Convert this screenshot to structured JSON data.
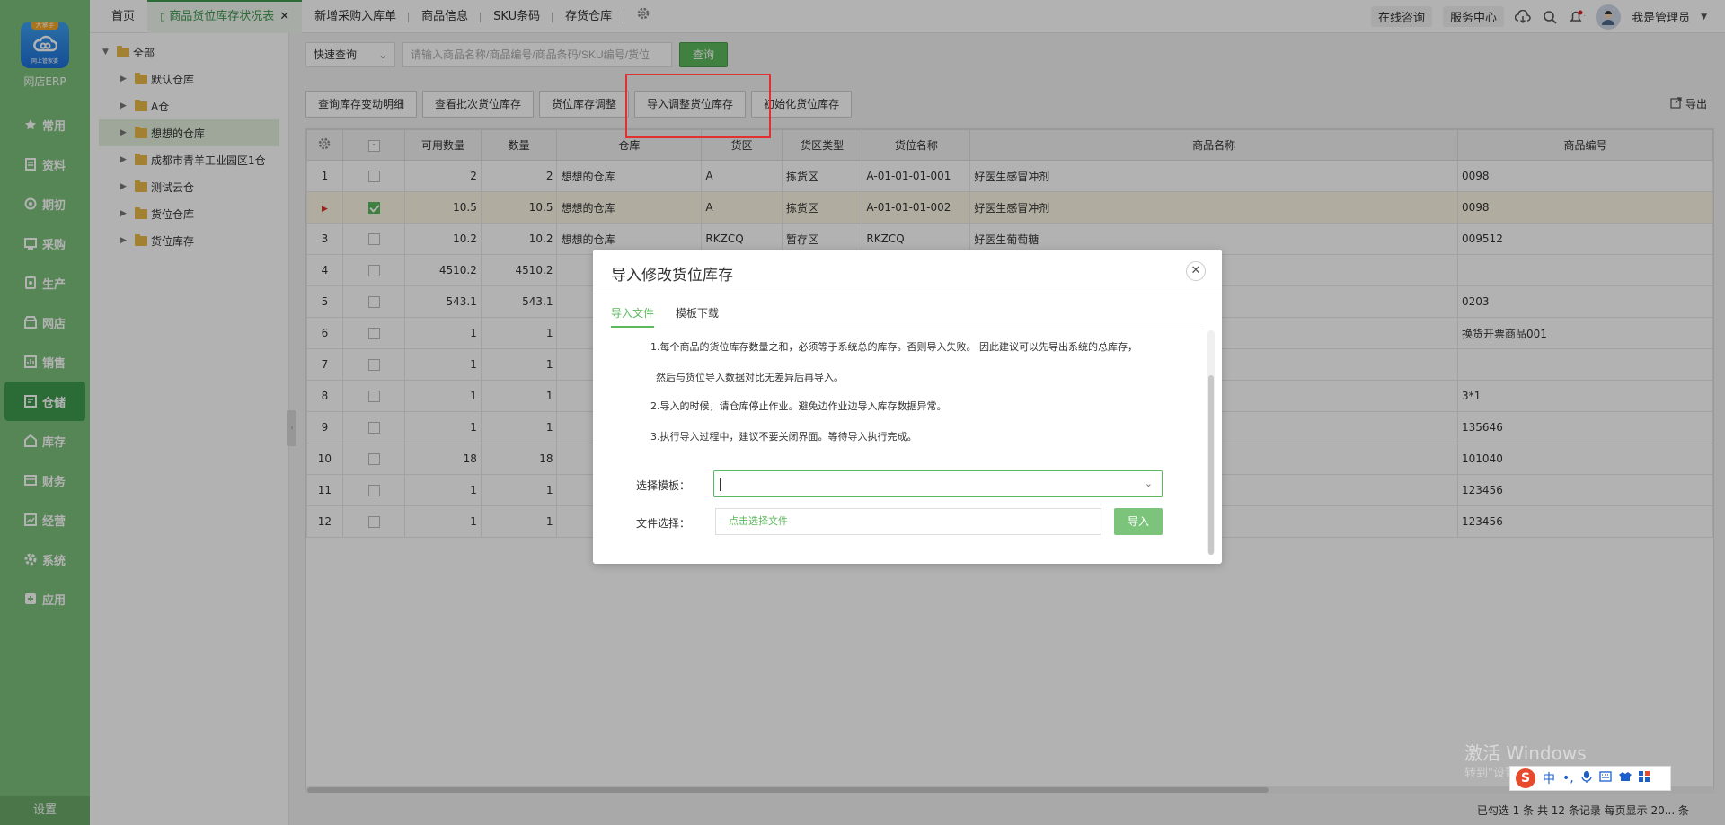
{
  "app": {
    "brand": "网店ERP",
    "logo_badge": "大掌手",
    "logo_sub": "网上管家婆",
    "settings_label": "设置"
  },
  "nav": [
    {
      "label": "常用",
      "icon": "star-icon"
    },
    {
      "label": "资料",
      "icon": "document-icon"
    },
    {
      "label": "期初",
      "icon": "target-icon"
    },
    {
      "label": "采购",
      "icon": "purchase-icon"
    },
    {
      "label": "生产",
      "icon": "production-icon"
    },
    {
      "label": "网店",
      "icon": "store-icon"
    },
    {
      "label": "销售",
      "icon": "chart-icon"
    },
    {
      "label": "仓储",
      "icon": "warehouse-icon"
    },
    {
      "label": "库存",
      "icon": "inventory-icon"
    },
    {
      "label": "财务",
      "icon": "finance-icon"
    },
    {
      "label": "经营",
      "icon": "business-icon"
    },
    {
      "label": "系统",
      "icon": "system-icon"
    },
    {
      "label": "应用",
      "icon": "apps-icon"
    }
  ],
  "tabs": [
    "首页",
    "商品货位库存状况表",
    "新增采购入库单",
    "商品信息",
    "SKU条码",
    "存货仓库"
  ],
  "topright": {
    "consult": "在线咨询",
    "service": "服务中心",
    "user": "我是管理员"
  },
  "tree": {
    "root": "全部",
    "items": [
      "默认仓库",
      "A仓",
      "想想的仓库",
      "成都市青羊工业园区1仓",
      "测试云仓",
      "货位仓库",
      "货位库存"
    ]
  },
  "search": {
    "mode": "快速查询",
    "placeholder": "请输入商品名称/商品编号/商品条码/SKU编号/货位",
    "button": "查询"
  },
  "actions": [
    "查询库存变动明细",
    "查看批次货位库存",
    "货位库存调整",
    "导入调整货位库存",
    "初始化货位库存"
  ],
  "export_label": "导出",
  "table": {
    "headers": [
      "可用数量",
      "数量",
      "仓库",
      "货区",
      "货区类型",
      "货位名称",
      "商品名称",
      "商品编号"
    ],
    "rows": [
      {
        "no": "1",
        "avail": "2",
        "qty": "2",
        "wh": "想想的仓库",
        "zone": "A",
        "ztype": "拣货区",
        "loc": "A-01-01-01-001",
        "name": "好医生感冒冲剂",
        "code": "0098"
      },
      {
        "no": "",
        "avail": "10.5",
        "qty": "10.5",
        "wh": "想想的仓库",
        "zone": "A",
        "ztype": "拣货区",
        "loc": "A-01-01-01-002",
        "name": "好医生感冒冲剂",
        "code": "0098"
      },
      {
        "no": "3",
        "avail": "10.2",
        "qty": "10.2",
        "wh": "想想的仓库",
        "zone": "RKZCQ",
        "ztype": "暂存区",
        "loc": "RKZCQ",
        "name": "好医生葡萄糖",
        "code": "009512"
      },
      {
        "no": "4",
        "avail": "4510.2",
        "qty": "4510.2",
        "wh": "",
        "zone": "",
        "ztype": "",
        "loc": "",
        "name": "",
        "code": ""
      },
      {
        "no": "5",
        "avail": "543.1",
        "qty": "543.1",
        "wh": "",
        "zone": "",
        "ztype": "",
        "loc": "",
        "name": "",
        "code": "0203"
      },
      {
        "no": "6",
        "avail": "1",
        "qty": "1",
        "wh": "",
        "zone": "",
        "ztype": "",
        "loc": "",
        "name": "",
        "code": "换货开票商品001"
      },
      {
        "no": "7",
        "avail": "1",
        "qty": "1",
        "wh": "",
        "zone": "",
        "ztype": "",
        "loc": "",
        "name": "",
        "code": ""
      },
      {
        "no": "8",
        "avail": "1",
        "qty": "1",
        "wh": "",
        "zone": "",
        "ztype": "",
        "loc": "",
        "name": "",
        "code": "3*1"
      },
      {
        "no": "9",
        "avail": "1",
        "qty": "1",
        "wh": "",
        "zone": "",
        "ztype": "",
        "loc": "",
        "name": "",
        "code": "135646"
      },
      {
        "no": "10",
        "avail": "18",
        "qty": "18",
        "wh": "",
        "zone": "",
        "ztype": "",
        "loc": "",
        "name": "",
        "code": "101040"
      },
      {
        "no": "11",
        "avail": "1",
        "qty": "1",
        "wh": "",
        "zone": "",
        "ztype": "",
        "loc": "",
        "name": "",
        "code": "123456"
      },
      {
        "no": "12",
        "avail": "1",
        "qty": "1",
        "wh": "",
        "zone": "",
        "ztype": "",
        "loc": "",
        "name": "",
        "code": "123456"
      }
    ]
  },
  "footer": "已勾选 1 条  共 12 条记录  每页显示 20...    条",
  "modal": {
    "title": "导入修改货位库存",
    "tabs": [
      "导入文件",
      "模板下载"
    ],
    "notes": [
      "1.每个商品的货位库存数量之和，必须等于系统总的库存。否则导入失败。 因此建议可以先导出系统的总库存，",
      "然后与货位导入数据对比无差异后再导入。",
      "2.导入的时候，请仓库停止作业。避免边作业边导入库存数据异常。",
      "3.执行导入过程中，建议不要关闭界面。等待导入执行完成。"
    ],
    "template_label": "选择模板：",
    "file_label": "文件选择：",
    "file_placeholder": "点击选择文件",
    "import_button": "导入"
  },
  "watermark": {
    "line1": "激活 Windows",
    "line2": "转到\"设置\"以激活 Windows。"
  },
  "ime": {
    "lang": "中"
  }
}
